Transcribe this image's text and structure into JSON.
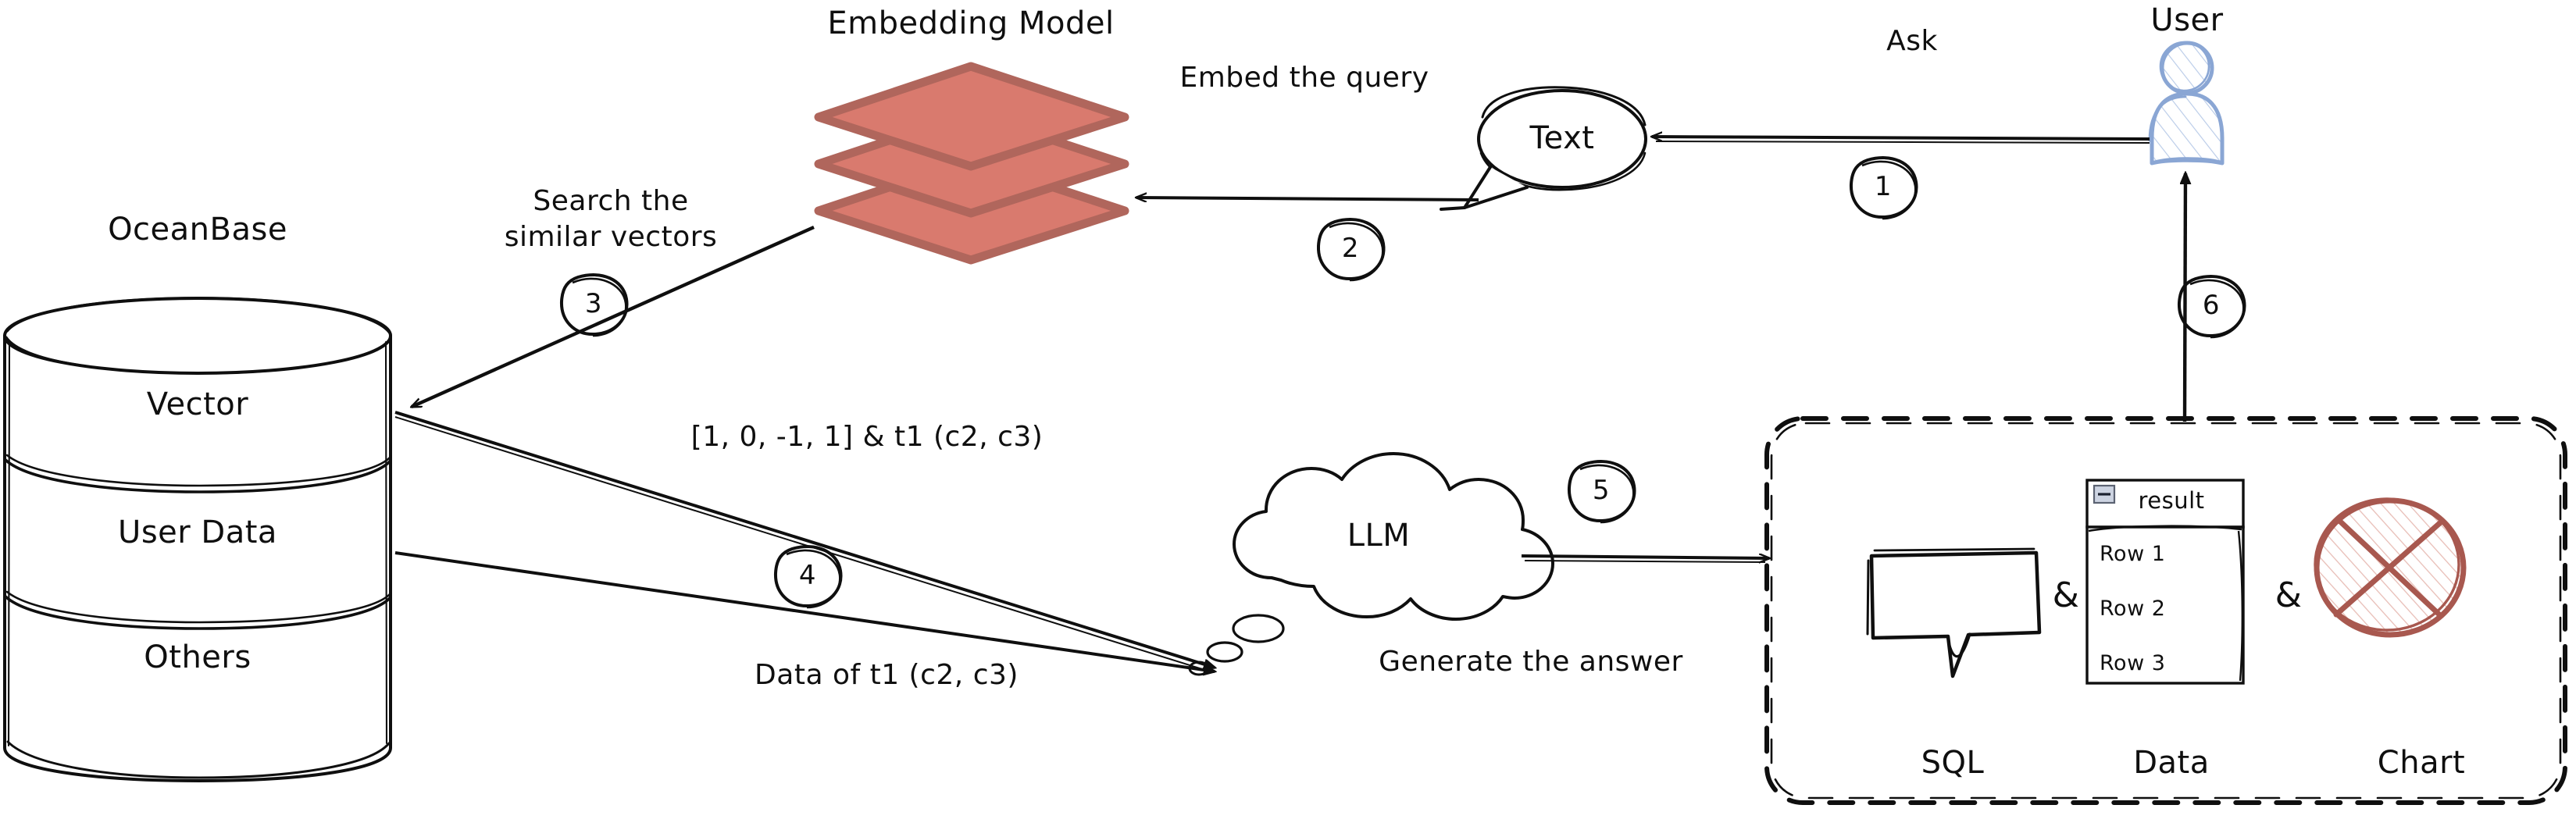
{
  "diagram": {
    "title_semantics": "RAG query flow with OceanBase vector database",
    "nodes": {
      "oceanbase": {
        "label": "OceanBase",
        "sections": [
          "Vector",
          "User Data",
          "Others"
        ]
      },
      "embedding_model": {
        "label": "Embedding Model",
        "layers": 3
      },
      "text_bubble": {
        "label": "Text"
      },
      "user": {
        "label": "User"
      },
      "llm": {
        "label": "LLM"
      },
      "output_panel": {
        "items": [
          "SQL",
          "Data",
          "Chart"
        ],
        "separators": [
          "&",
          "&"
        ],
        "data_table": {
          "title": "result",
          "collapse_icon": "minus-box-icon",
          "rows": [
            "Row 1",
            "Row 2",
            "Row 3"
          ]
        }
      }
    },
    "edges": [
      {
        "step": "1",
        "label": "Ask",
        "from": "User",
        "to": "Text"
      },
      {
        "step": "2",
        "label": "Embed the query",
        "from": "Text",
        "to": "Embedding Model"
      },
      {
        "step": "3",
        "label": "Search the\nsimilar vectors",
        "line1": "Search the",
        "line2": "similar vectors",
        "from": "Embedding Model",
        "to": "OceanBase"
      },
      {
        "step": "4",
        "label": "[1, 0, -1, 1] & t1 (c2, c3)",
        "from": "OceanBase",
        "to": "LLM"
      },
      {
        "step": "4b",
        "label": "Data of t1 (c2, c3)",
        "from": "OceanBase",
        "to": "LLM"
      },
      {
        "step": "5",
        "label": "Generate the answer",
        "from": "LLM",
        "to": "Output panel"
      },
      {
        "step": "6",
        "label": "",
        "from": "Output panel",
        "to": "User"
      }
    ],
    "step_numbers": [
      "1",
      "2",
      "3",
      "4",
      "5",
      "6"
    ],
    "colors": {
      "ink": "#0f0f0f",
      "embedding_fill": "#d97a6e",
      "embedding_stroke": "#b0665c",
      "user_stroke": "#8aa6d4",
      "user_fill": "#eef3fb",
      "chart_stroke": "#a8584f",
      "chart_fill": "#f4dedb",
      "background": "#ffffff"
    }
  }
}
